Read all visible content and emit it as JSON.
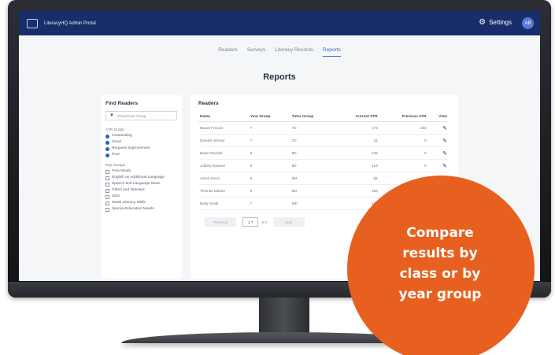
{
  "app": {
    "title": "LiteracyHQ Admin Portal"
  },
  "header": {
    "settings_label": "Settings",
    "settings_icon": "gear-icon",
    "avatar_initials": "AB"
  },
  "nav": {
    "tabs": [
      "Readers",
      "Surveys",
      "Literacy Records",
      "Reports"
    ],
    "active": "Reports"
  },
  "page": {
    "title": "Reports"
  },
  "filter": {
    "title": "Find Readers",
    "button_label": "Class/Tutor Group",
    "atr_grade_label": "ATR Grade",
    "atr_grades": [
      "Outstanding",
      "Good",
      "Requires Improvement",
      "Poor"
    ],
    "key_groups_label": "Key Groups",
    "key_groups": [
      "Free Meals",
      "English as Additional Language",
      "Speech and Language Issue",
      "Gifted and Talented",
      "SEN",
      "Weak Literacy Skills",
      "Special Education Needs"
    ]
  },
  "readers": {
    "title": "Readers",
    "columns": [
      "Name",
      "Year Group",
      "Tutor Group",
      "Current ATR",
      "Previous ATR",
      "View"
    ],
    "rows": [
      [
        "Bacon Francis",
        "7",
        "7D",
        "173",
        "283"
      ],
      [
        "Daniels Johnny",
        "7",
        "7D",
        "15",
        "0"
      ],
      [
        "Baker Russell",
        "8",
        "8D",
        "245",
        "0"
      ],
      [
        "Jobbey Edward",
        "8",
        "8D",
        "419",
        "0"
      ],
      [
        "Aaron Kevin",
        "8",
        "8M",
        "55",
        "0"
      ],
      [
        "Thomas Edison",
        "8",
        "8M",
        "156",
        "0"
      ],
      [
        "Betty Smith",
        "7",
        "MD",
        "156",
        "0"
      ]
    ],
    "pager": {
      "prev": "Previous",
      "page": "1",
      "of": "of 1",
      "next": "Next"
    }
  },
  "callout": {
    "lines": [
      "Compare",
      "results by",
      "class or by",
      "year group"
    ],
    "color": "#e8601f"
  },
  "colors": {
    "appbar": "#172e6b",
    "accent": "#3d66c9",
    "radio": "#2d5bd6"
  }
}
